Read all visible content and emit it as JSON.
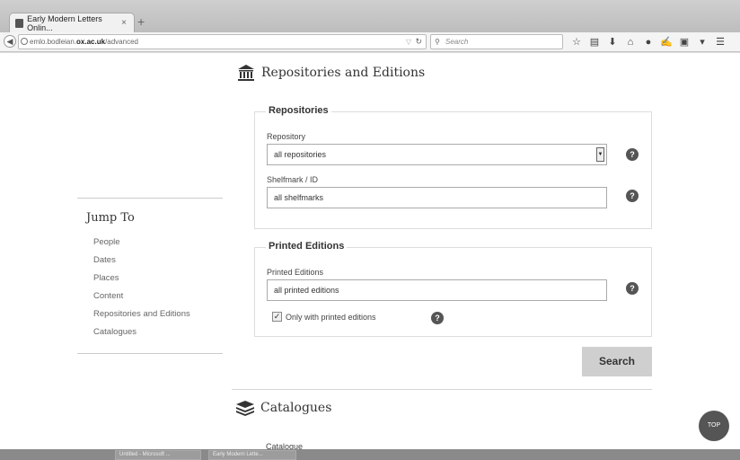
{
  "browser": {
    "tab_title": "Early Modern Letters Onlin...",
    "tab_close": "×",
    "new_tab": "+",
    "url_prefix": "emlo.bodleian.",
    "url_domain": "ox.ac.uk",
    "url_path": "/advanced",
    "search_placeholder": "Search"
  },
  "section": {
    "title": "Repositories and Editions"
  },
  "sidebar": {
    "heading": "Jump To",
    "items": [
      {
        "label": "People"
      },
      {
        "label": "Dates"
      },
      {
        "label": "Places"
      },
      {
        "label": "Content"
      },
      {
        "label": "Repositories and Editions"
      },
      {
        "label": "Catalogues"
      }
    ]
  },
  "repositories": {
    "legend": "Repositories",
    "repository_label": "Repository",
    "repository_value": "all repositories",
    "shelfmark_label": "Shelfmark / ID",
    "shelfmark_value": "all shelfmarks"
  },
  "editions": {
    "legend": "Printed Editions",
    "printed_label": "Printed Editions",
    "printed_value": "all printed editions",
    "only_printed_label": "Only with printed editions",
    "only_printed_checked": true
  },
  "buttons": {
    "search": "Search",
    "top": "TOP",
    "help": "?"
  },
  "catalogues": {
    "title": "Catalogues",
    "catalogue_label": "Catalogue"
  },
  "taskbar": {
    "items": [
      "Untitled - Microsoft ...",
      "Early Modern Lette..."
    ]
  }
}
